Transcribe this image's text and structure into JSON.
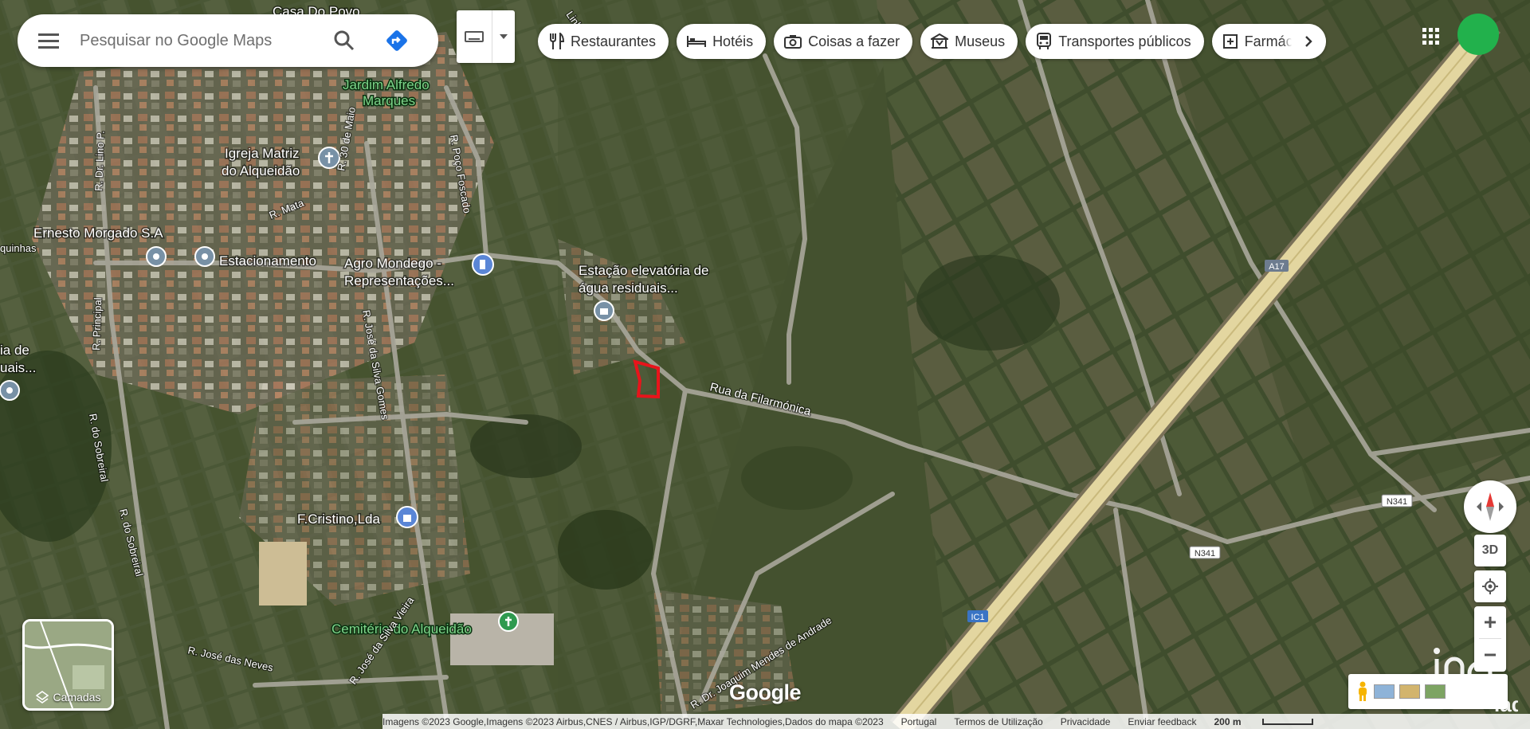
{
  "search": {
    "placeholder": "Pesquisar no Google Maps"
  },
  "chips": [
    {
      "label": "Restaurantes",
      "icon": "fork-knife-icon"
    },
    {
      "label": "Hotéis",
      "icon": "bed-icon"
    },
    {
      "label": "Coisas a fazer",
      "icon": "camera-icon"
    },
    {
      "label": "Museus",
      "icon": "museum-icon"
    },
    {
      "label": "Transportes públicos",
      "icon": "bus-icon"
    },
    {
      "label": "Farmácias",
      "icon": "pharmacy-icon"
    }
  ],
  "map_labels": {
    "casa_do_povo": "Casa Do Povo",
    "jardim": "Jardim Alfredo",
    "jardim2": "Marques",
    "igreja": "Igreja Matriz",
    "igreja2": "do Alqueidão",
    "ernesto": "Ernesto Morgado S.A",
    "estacionamento": "Estacionamento",
    "agro": "Agro Mondego -",
    "agro2": "Representações...",
    "estacao": "Estação elevatória de",
    "estacao2": "água residuais...",
    "left_cut": "ia de",
    "left_cut2": "uais...",
    "fcristino": "F.Cristino,Lda",
    "cemiterio": "Cemitério do Alqueidão"
  },
  "road_labels": {
    "rua_filarmonica": "Rua da Filarmónica",
    "r_poco_foscado": "R. Poço Foscado",
    "r_mata": "R. Mata",
    "r_30_maio": "R. 30 de Maio",
    "r_dr_lino": "R. Dr. Lino P.",
    "r_principal": "R. Principal",
    "r_sobreiral": "R. do Sobreiral",
    "r_sobreiral2": "R. do Sobreiral",
    "r_jose_silva_gomes": "R. José da Silva Gomes",
    "r_joaquim_mendes": "R. Dr. Joaquim Mendes de Andrade",
    "r_jose_neves": "R. José das Neves",
    "r_jose_vieira": "R. José da Silva Vieira",
    "r_quinhas": "quinhas",
    "r_linhas": "Linhas",
    "a17": "A17",
    "n341a": "N341",
    "n341b": "N341",
    "ic1": "IC1"
  },
  "layers": {
    "label": "Camadas"
  },
  "controls": {
    "three_d": "3D"
  },
  "google_logo": "Google",
  "footer": {
    "imagery": "Imagens ©2023 Google,Imagens ©2023 Airbus,CNES / Airbus,IGP/DGRF,Maxar Technologies,Dados do mapa ©2023",
    "country": "Portugal",
    "terms": "Termos de Utilização",
    "privacy": "Privacidade",
    "feedback": "Enviar feedback",
    "scale": "200 m"
  },
  "colors": {
    "avatar": "#22b14c",
    "parcel_outline": "#e8141b",
    "highway": "#e3d6a0"
  }
}
